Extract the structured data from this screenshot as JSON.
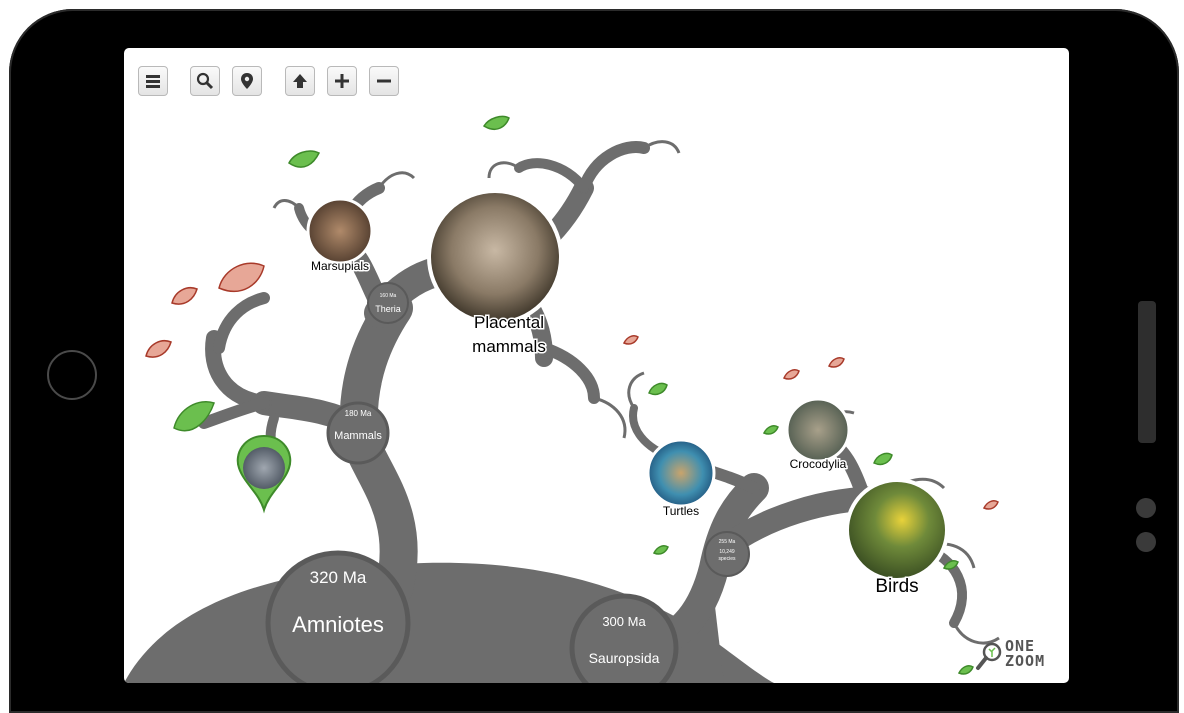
{
  "toolbar": {
    "buttons": [
      {
        "name": "menu-button",
        "icon": "hamburger-menu-icon"
      },
      {
        "name": "search-button",
        "icon": "search-icon"
      },
      {
        "name": "location-button",
        "icon": "map-pin-icon"
      },
      {
        "name": "up-button",
        "icon": "arrow-up-icon"
      },
      {
        "name": "zoom-in-button",
        "icon": "plus-icon"
      },
      {
        "name": "zoom-out-button",
        "icon": "minus-icon"
      }
    ]
  },
  "nodes": {
    "amniotes": {
      "age": "320 Ma",
      "name": "Amniotes"
    },
    "sauropsida": {
      "age": "300 Ma",
      "name": "Sauropsida"
    },
    "mammals": {
      "age": "180 Ma",
      "name": "Mammals"
    },
    "theria": {
      "age": "160 Ma",
      "name": "Theria"
    },
    "reptiles_node": {
      "age": "255 Ma",
      "species": "10,249",
      "species_label": "species"
    }
  },
  "groups": {
    "marsupials": "Marsupials",
    "placental": [
      "Placental",
      "mammals"
    ],
    "turtles": "Turtles",
    "crocodylia": "Crocodylia",
    "birds": "Birds"
  },
  "logo": {
    "line1": "ONE",
    "line2": "ZOOM"
  },
  "colors": {
    "branch": "#6d6d6d",
    "leaf_green": "#6bbf4e",
    "leaf_red": "#d98a7c",
    "node_ring": "#5c5c5c"
  }
}
